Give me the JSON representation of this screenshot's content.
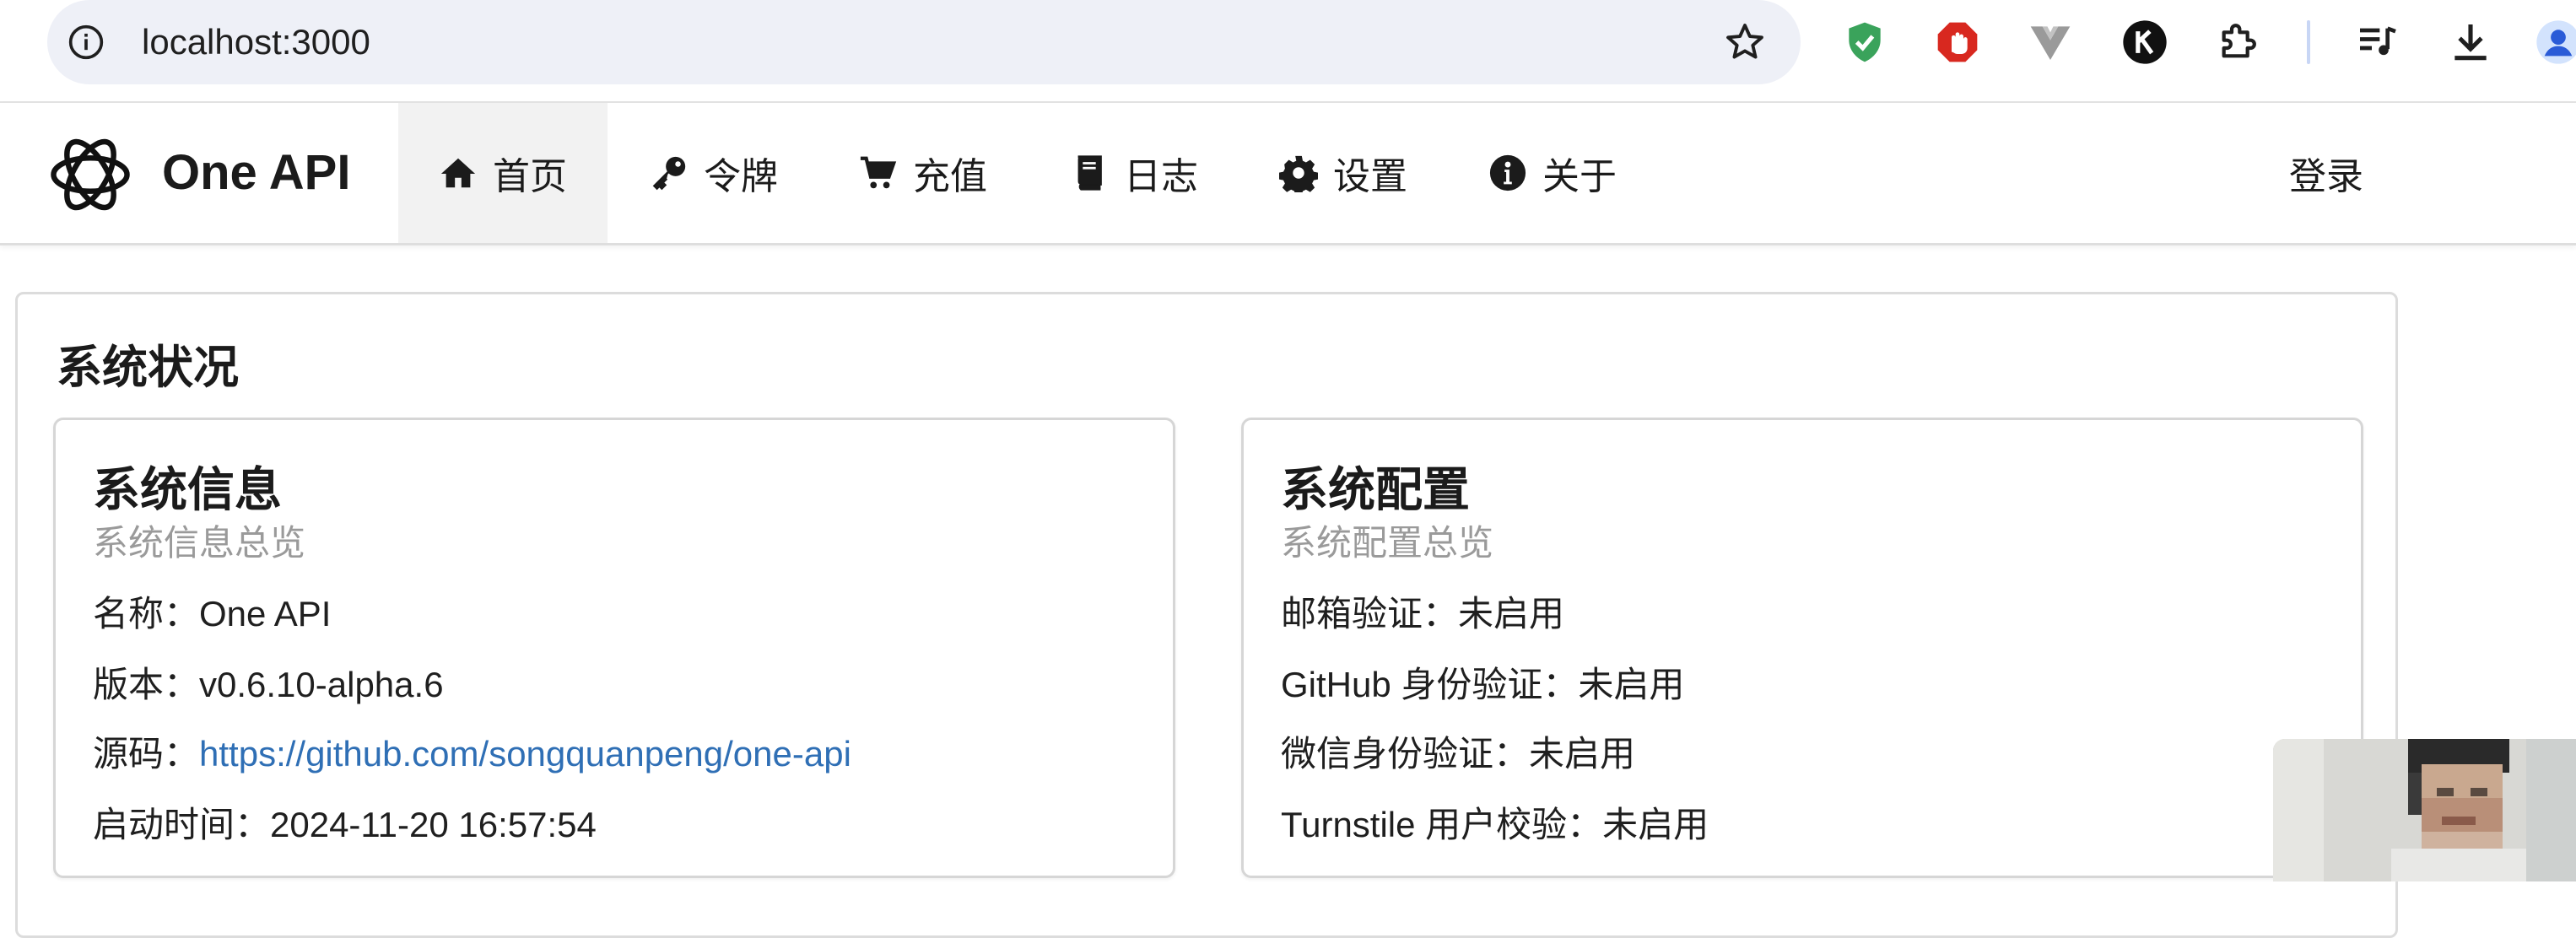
{
  "browser": {
    "url": "localhost:3000"
  },
  "app": {
    "brand": "One API",
    "nav": [
      {
        "label": "首页",
        "icon": "home-icon"
      },
      {
        "label": "令牌",
        "icon": "key-icon"
      },
      {
        "label": "充值",
        "icon": "cart-icon"
      },
      {
        "label": "日志",
        "icon": "book-icon"
      },
      {
        "label": "设置",
        "icon": "gear-icon"
      },
      {
        "label": "关于",
        "icon": "info-icon"
      }
    ],
    "login": "登录"
  },
  "status": {
    "title": "系统状况",
    "info": {
      "title": "系统信息",
      "subtitle": "系统信息总览",
      "name": "名称：One API",
      "version": "版本：v0.6.10-alpha.6",
      "source_label": "源码：",
      "source_url": "https://github.com/songquanpeng/one-api",
      "start_time": "启动时间：2024-11-20 16:57:54"
    },
    "config": {
      "title": "系统配置",
      "subtitle": "系统配置总览",
      "email": "邮箱验证：未启用",
      "github": "GitHub 身份验证：未启用",
      "wechat": "微信身份验证：未启用",
      "turnstile": "Turnstile 用户校验：未启用"
    }
  },
  "colors": {
    "link": "#2f6fb5",
    "subtitle": "#9a9a9a",
    "omnibox": "#eef0f7"
  }
}
